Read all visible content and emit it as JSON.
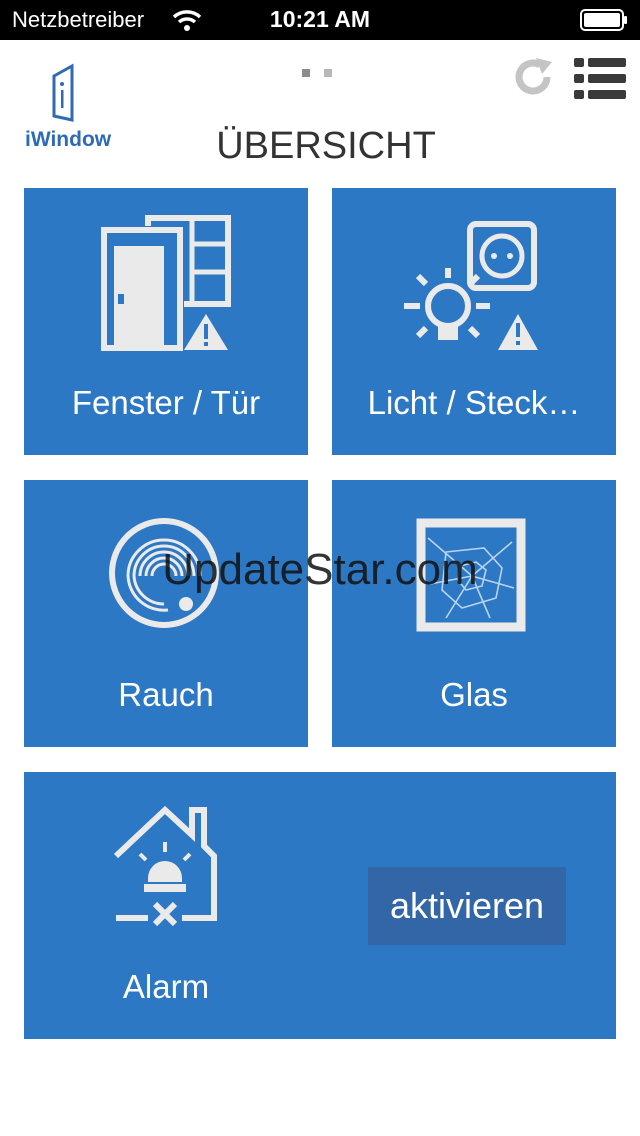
{
  "status_bar": {
    "carrier": "Netzbetreiber",
    "time": "10:21 AM"
  },
  "header": {
    "logo_text": "iWindow",
    "title": "ÜBERSICHT",
    "page_count": 2,
    "active_page": 1,
    "refresh_icon": "refresh-icon",
    "menu_icon": "list-menu-icon"
  },
  "tiles": [
    {
      "label": "Fenster / Tür",
      "icon": "door-window-icon",
      "warning": true
    },
    {
      "label": "Licht / Steck…",
      "icon": "light-socket-icon",
      "warning": true
    },
    {
      "label": "Rauch",
      "icon": "smoke-detector-icon",
      "warning": false
    },
    {
      "label": "Glas",
      "icon": "broken-glass-icon",
      "warning": false
    },
    {
      "label": "Alarm",
      "icon": "house-alarm-icon",
      "warning": false
    }
  ],
  "alarm": {
    "activate_label": "aktivieren"
  },
  "watermark": "UpdateStar.com",
  "colors": {
    "tile": "#2d78c4",
    "button": "#3266a6",
    "brand": "#2e6ab5",
    "status_bar": "#000000"
  }
}
